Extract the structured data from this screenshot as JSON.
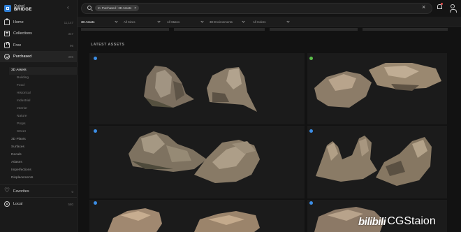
{
  "app": {
    "logo_line1": "Quixel",
    "logo_line2": "BRIDGE",
    "collapse_glyph": "‹",
    "brand_color": "#2f7fd6"
  },
  "sidebar": {
    "items": [
      {
        "label": "Home",
        "count": "11,147",
        "icon": "home-icon"
      },
      {
        "label": "Collections",
        "count": "347",
        "icon": "collections-icon"
      },
      {
        "label": "Free",
        "count": "96",
        "icon": "free-icon"
      },
      {
        "label": "Purchased",
        "count": "396",
        "icon": "purchased-icon"
      }
    ],
    "subitems": {
      "assets_3d": "3D Assets",
      "building": "Building",
      "food": "Food",
      "historical": "Historical",
      "industrial": "Industrial",
      "interior": "Interior",
      "nature": "Nature",
      "props": "Props",
      "street": "Street",
      "plants_3d": "3D Plants",
      "surfaces": "Surfaces",
      "decals": "Decals",
      "atlases": "Atlases",
      "imperfections": "Imperfections",
      "displacements": "Displacements"
    },
    "bottom": [
      {
        "label": "Favorites",
        "count": "0",
        "icon": "heart-icon"
      },
      {
        "label": "Local",
        "count": "580",
        "icon": "local-icon"
      }
    ]
  },
  "search": {
    "chip_label": "In: Purchased / 3D Assets",
    "chip_close": "×",
    "clear_glyph": "×"
  },
  "filters": [
    {
      "label": "3D Assets",
      "active": true
    },
    {
      "label": "All Sizes",
      "active": false
    },
    {
      "label": "All States",
      "active": false
    },
    {
      "label": "3D Environments",
      "active": false
    },
    {
      "label": "All Colors",
      "active": false
    }
  ],
  "main": {
    "section_title": "LATEST ASSETS"
  },
  "cards": [
    {
      "badge": "#3c8ee6"
    },
    {
      "badge": "#5bbf4a"
    },
    {
      "badge": "#3c8ee6"
    },
    {
      "badge": "#3c8ee6"
    },
    {
      "badge": "#3c8ee6"
    },
    {
      "badge": "#3c8ee6"
    }
  ],
  "watermark": {
    "bili": "bilibili",
    "text": "CGStaion"
  }
}
